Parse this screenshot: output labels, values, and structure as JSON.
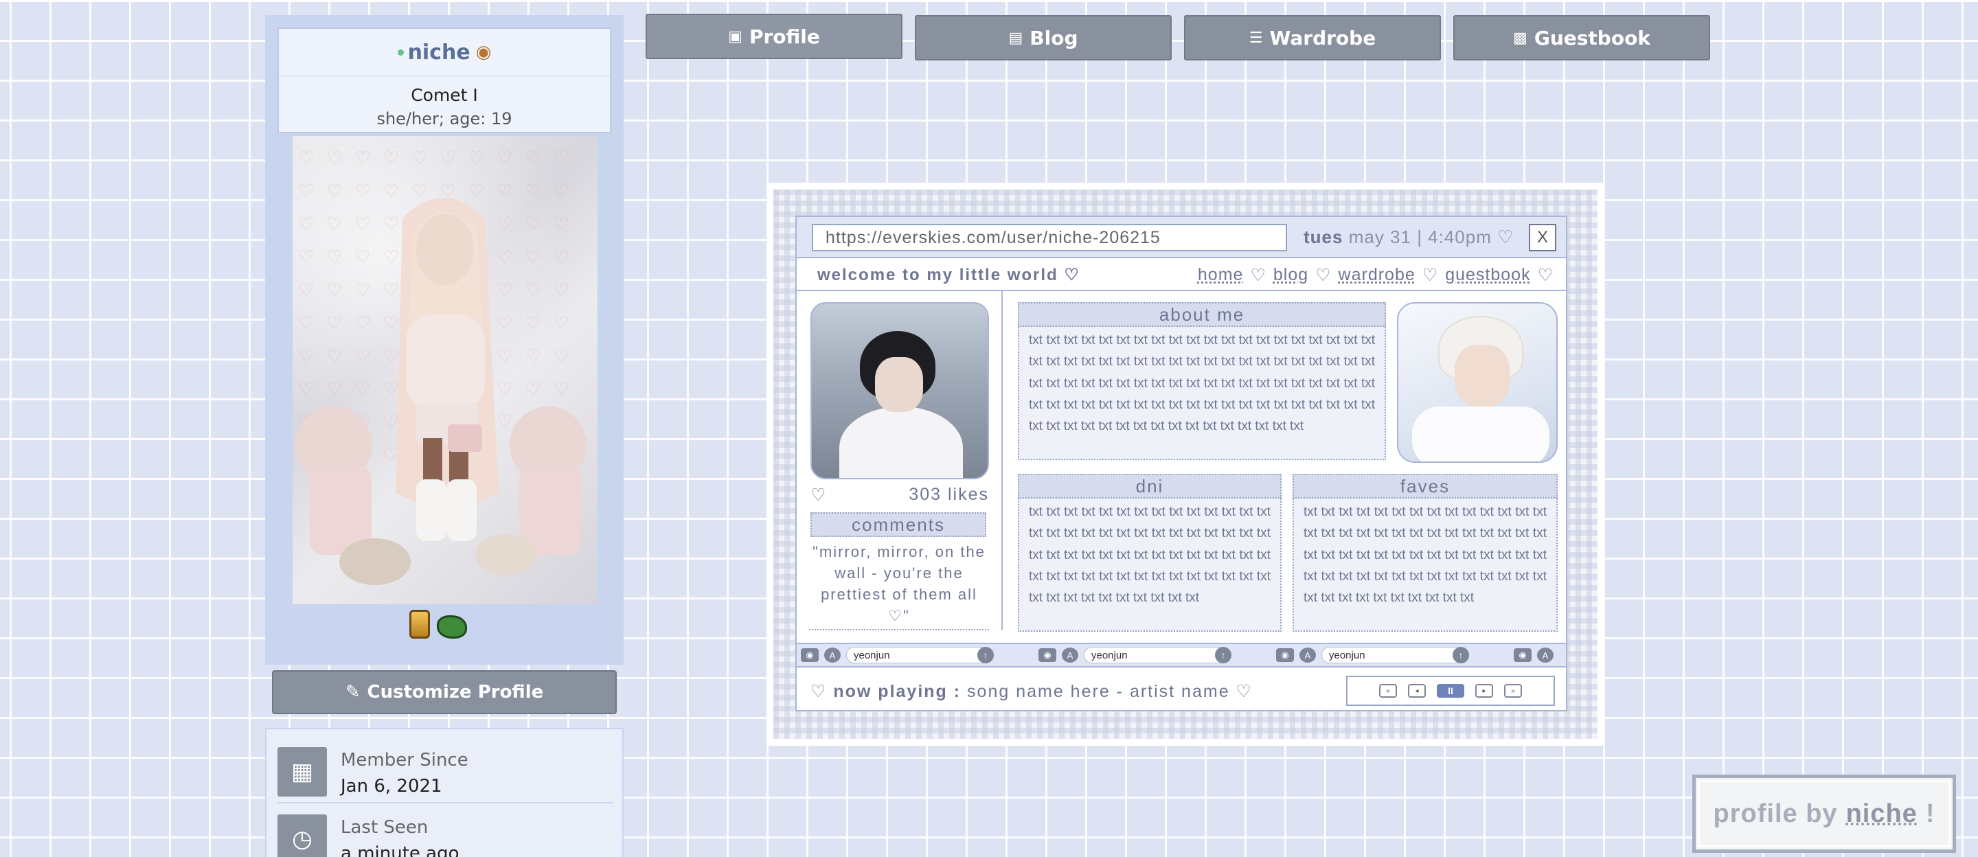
{
  "tabs": [
    {
      "label": "Profile",
      "icon": "id-card-icon"
    },
    {
      "label": "Blog",
      "icon": "notebook-icon"
    },
    {
      "label": "Wardrobe",
      "icon": "dresser-icon"
    },
    {
      "label": "Guestbook",
      "icon": "speech-book-icon"
    }
  ],
  "user": {
    "username": "niche",
    "title": "Comet I",
    "info": "she/her; age: 19",
    "status_color": "#6bc08a"
  },
  "customize_label": "Customize Profile",
  "stats": [
    {
      "label": "Member Since",
      "value": "Jan 6, 2021",
      "icon": "calendar-icon"
    },
    {
      "label": "Last Seen",
      "value": "a minute ago",
      "icon": "clock-icon"
    }
  ],
  "embed": {
    "url": "https://everskies.com/user/niche-206215",
    "day": "tues",
    "datetime_rest": "may 31 | 4:40pm ♡",
    "close": "X",
    "welcome": "welcome to my little world ♡",
    "nav": [
      "home",
      "blog",
      "wardrobe",
      "guestbook"
    ],
    "nav_sep": "♡",
    "likes_heart": "♡",
    "likes": "303 likes",
    "comments_title": "comments",
    "quote": "\"mirror, mirror, on the wall - you're the prettiest of them all ♡\"",
    "about_title": "about me",
    "about_text": "txt txt txt txt txt txt txt txt txt txt txt txt txt txt txt txt txt txt txt txt txt txt txt txt txt txt txt txt txt txt txt txt txt txt txt txt txt txt txt txt txt txt txt txt txt txt txt txt txt txt txt txt txt txt txt txt txt txt txt txt txt txt txt txt txt txt txt txt txt txt txt txt txt txt txt txt txt txt txt txt txt txt txt txt txt txt txt txt txt txt txt txt txt txt txt txt",
    "dni_title": "dni",
    "dni_text": "txt txt txt txt txt txt txt txt txt txt txt txt txt txt txt txt txt txt txt txt txt txt txt txt txt txt txt txt txt txt txt txt txt txt txt txt txt txt txt txt txt txt txt txt txt txt txt txt txt txt txt txt txt txt txt txt txt txt txt txt txt txt txt txt txt txt",
    "faves_title": "faves",
    "faves_text": "txt txt txt txt txt txt txt txt txt txt txt txt txt txt txt txt txt txt txt txt txt txt txt txt txt txt txt txt txt txt txt txt txt txt txt txt txt txt txt txt txt txt txt txt txt txt txt txt txt txt txt txt txt txt txt txt txt txt txt txt txt txt txt txt txt txt",
    "mini_fields": [
      "yeonjun",
      "yeonjun",
      "yeonjun"
    ],
    "now_playing_prefix": "♡",
    "now_playing_label": "now playing :",
    "now_playing_text": "song name here - artist name ♡"
  },
  "credit": {
    "prefix": "profile by",
    "name": "niche",
    "suffix": "!"
  }
}
